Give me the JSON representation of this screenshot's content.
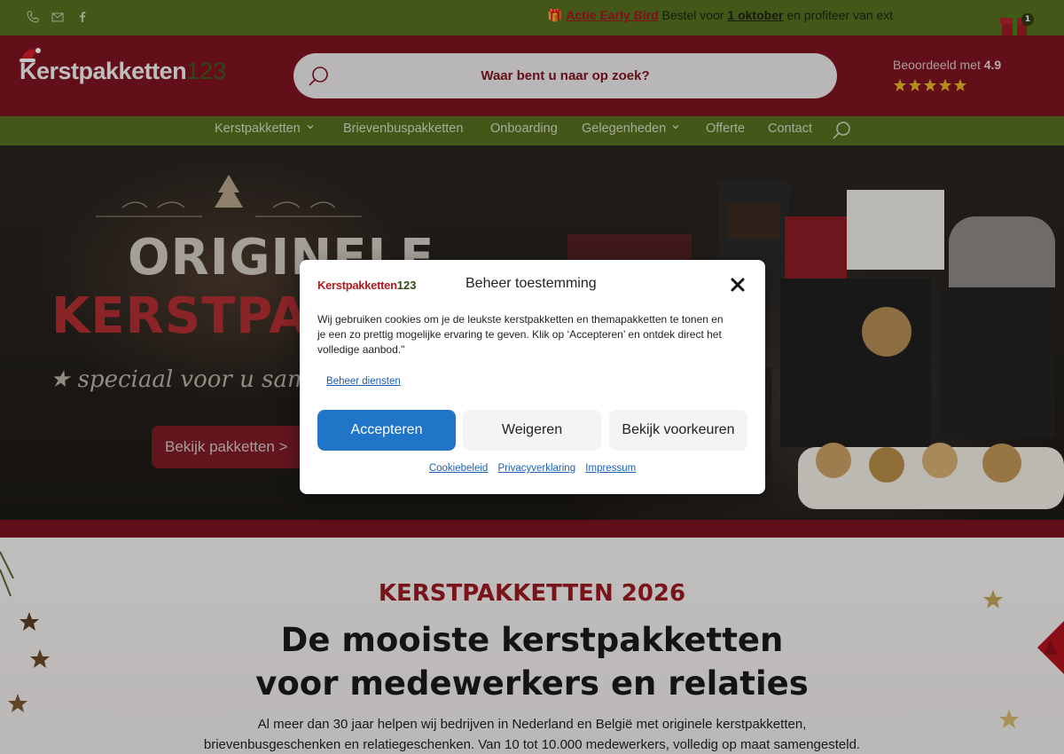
{
  "topbar": {
    "icons": [
      "phone-icon",
      "mail-icon",
      "facebook-icon"
    ],
    "promo": {
      "gift_icon": "gift-icon",
      "highlight": "Actie Early Bird",
      "text1": " Bestel voor ",
      "date": "1 oktober",
      "text2": " en profiteer van ext"
    },
    "cart_count": "1"
  },
  "header": {
    "logo_text": "Kerstpakketten",
    "logo_number": "123",
    "search_placeholder": "Waar bent u naar op zoek?",
    "rating_label": "Beoordeeld met",
    "rating_value": "4.9",
    "stars": 5
  },
  "nav": {
    "items": [
      {
        "label": "Kerstpakketten",
        "dropdown": true
      },
      {
        "label": "Brievenbuspakketten",
        "dropdown": false
      },
      {
        "label": "Onboarding",
        "dropdown": false
      },
      {
        "label": "Gelegenheden",
        "dropdown": true
      },
      {
        "label": "Offerte",
        "dropdown": false
      },
      {
        "label": "Contact",
        "dropdown": false
      }
    ]
  },
  "hero": {
    "title_line1": "ORIGINELE",
    "title_line2": "KERSTPAKKETTEN",
    "subtitle": "speciaal voor u samengesteld",
    "cta": "Bekijk pakketten >"
  },
  "section": {
    "kicker": "KERSTPAKKETTEN 2026",
    "heading_line1": "De mooiste kerstpakketten",
    "heading_line2": "voor medewerkers en relaties",
    "intro_line1": "Al meer dan 30 jaar helpen wij bedrijven in Nederland en België met originele kerstpakketten,",
    "intro_line2": "brievenbusgeschenken en relatiegeschenken. Van 10 tot 10.000 medewerkers, volledig op maat samengesteld."
  },
  "cookie_modal": {
    "logo_text": "Kerstpakketten",
    "logo_number": "123",
    "title": "Beheer toestemming",
    "body": "Wij gebruiken cookies om je de leukste kerstpakketten en themapakketten te tonen en je een zo prettig mogelijke ervaring te geven. Klik op ‘Accepteren’ en ontdek direct het volledige aanbod.\"",
    "manage_link": "Beheer diensten",
    "accept": "Accepteren",
    "deny": "Weigeren",
    "preferences": "Bekijk voorkeuren",
    "links": [
      "Cookiebeleid",
      "Privacyverklaring",
      "Impressum"
    ]
  },
  "colors": {
    "topbar": "#55701f",
    "header": "#7e1421",
    "nav": "#56701f",
    "accent_red": "#9b1c22",
    "accept_blue": "#2175c9",
    "link_blue": "#1e5fb4"
  }
}
